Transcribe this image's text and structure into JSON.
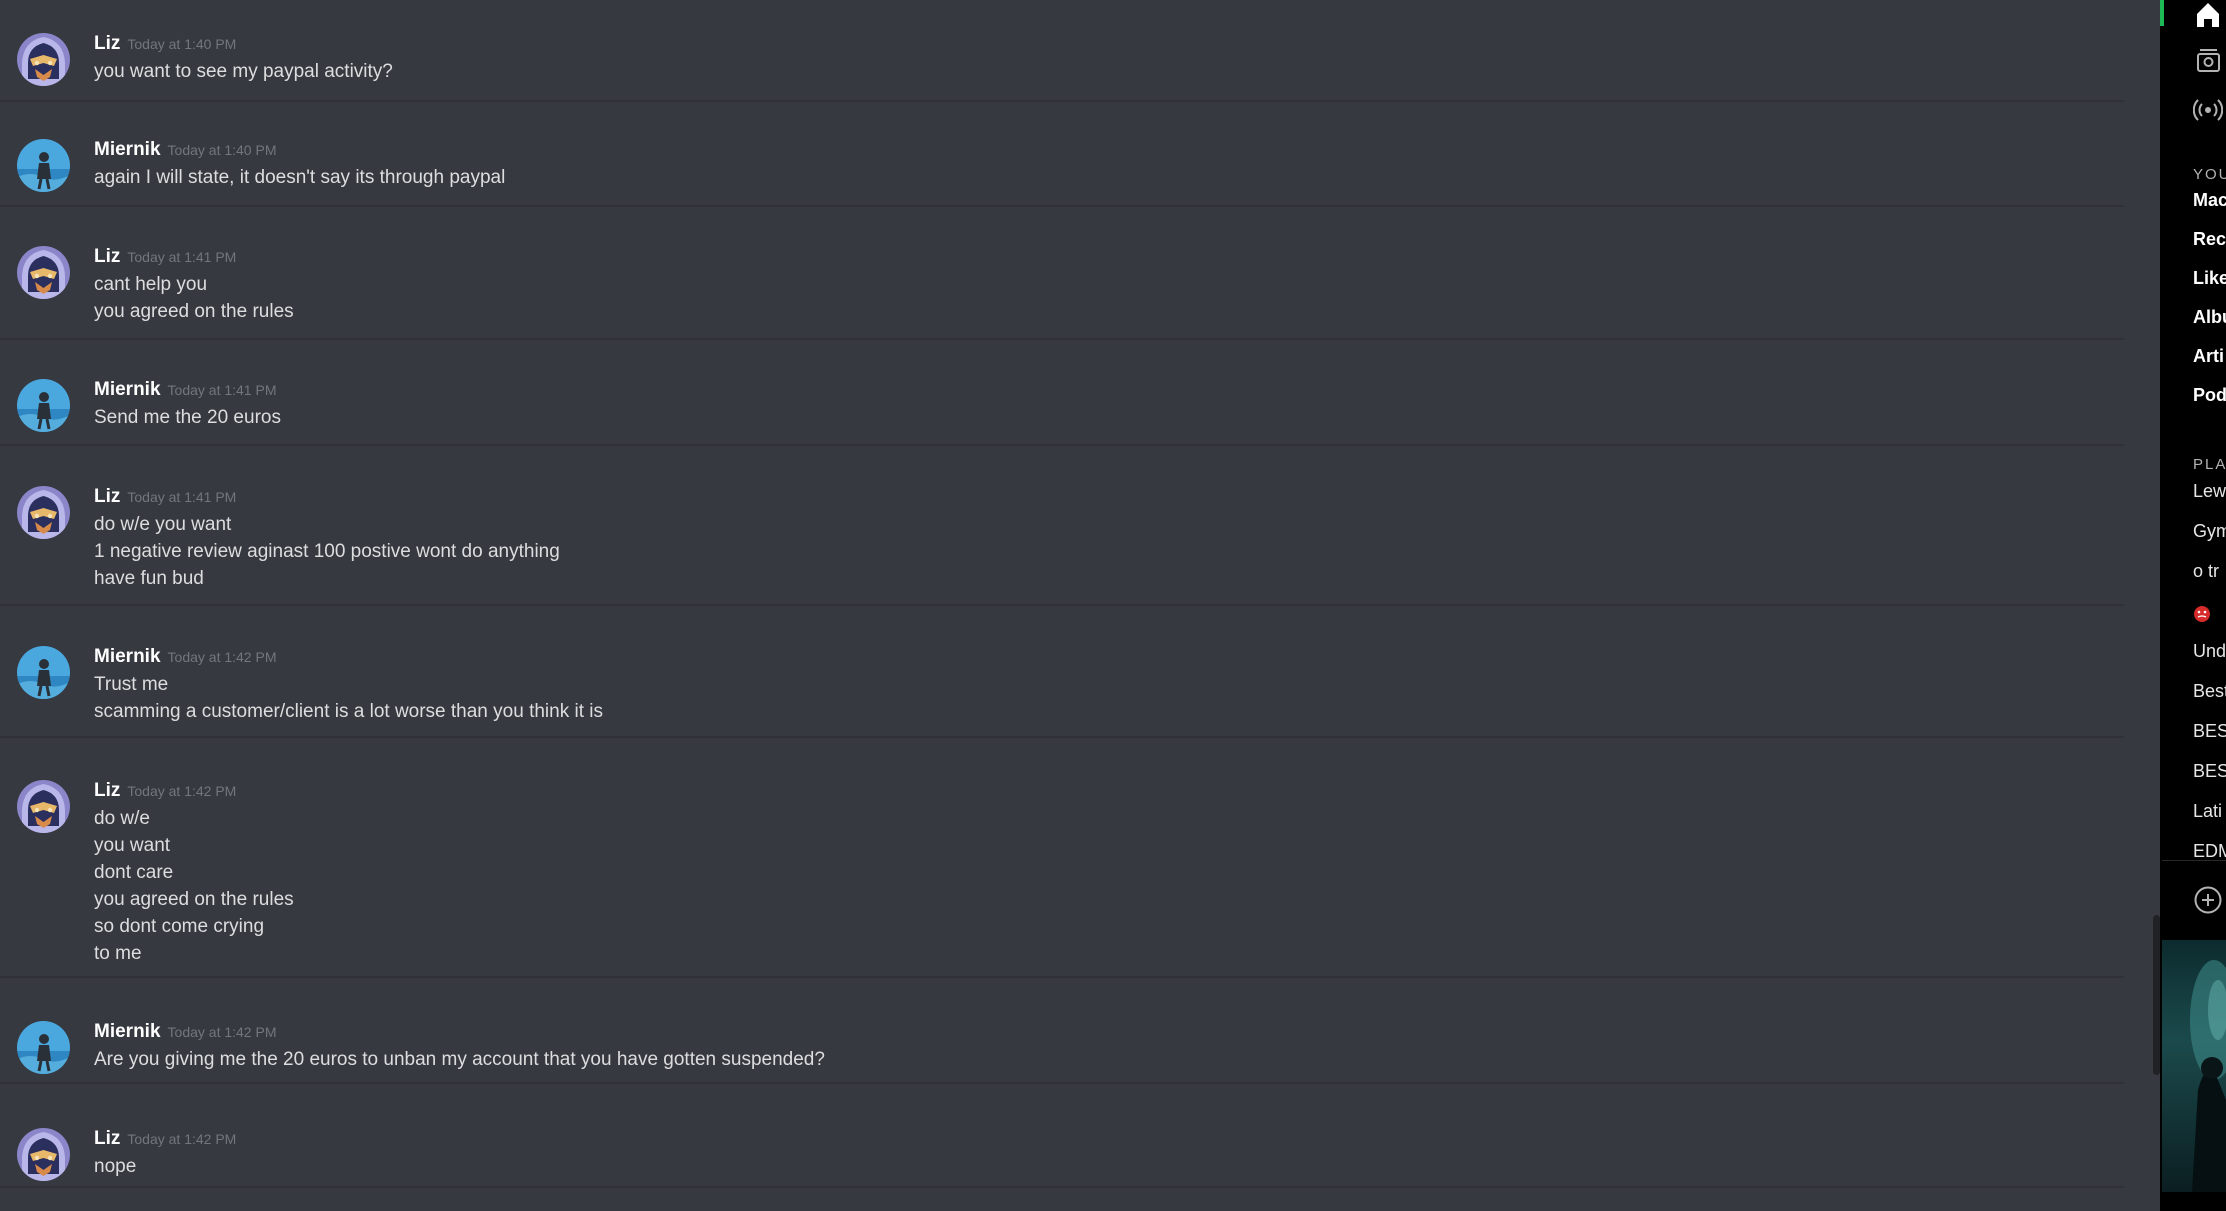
{
  "messages": [
    {
      "user": "Liz",
      "avatar": "liz-avatar",
      "time": "Today at 1:40 PM",
      "lines": [
        "you want to see my paypal activity?"
      ]
    },
    {
      "user": "Miernik",
      "avatar": "miernik-avatar",
      "time": "Today at 1:40 PM",
      "lines": [
        "again I will state, it doesn't say its through paypal"
      ]
    },
    {
      "user": "Liz",
      "avatar": "liz-avatar",
      "time": "Today at 1:41 PM",
      "lines": [
        "cant help you",
        "you agreed on the rules"
      ]
    },
    {
      "user": "Miernik",
      "avatar": "miernik-avatar",
      "time": "Today at 1:41 PM",
      "lines": [
        "Send me the 20 euros"
      ]
    },
    {
      "user": "Liz",
      "avatar": "liz-avatar",
      "time": "Today at 1:41 PM",
      "lines": [
        "do w/e you want",
        "1 negative review aginast 100 postive wont do anything",
        "have fun bud"
      ]
    },
    {
      "user": "Miernik",
      "avatar": "miernik-avatar",
      "time": "Today at 1:42 PM",
      "lines": [
        "Trust me",
        "scamming a customer/client is a lot worse than you think it is"
      ]
    },
    {
      "user": "Liz",
      "avatar": "liz-avatar",
      "time": "Today at 1:42 PM",
      "lines": [
        "do w/e",
        "you want",
        "dont care",
        "you agreed on the rules",
        "so dont come crying",
        "to me"
      ]
    },
    {
      "user": "Miernik",
      "avatar": "miernik-avatar",
      "time": "Today at 1:42 PM",
      "lines": [
        "Are you giving me the 20 euros to unban my account that you have gotten suspended?"
      ]
    },
    {
      "user": "Liz",
      "avatar": "liz-avatar",
      "time": "Today at 1:42 PM",
      "lines": [
        "nope"
      ]
    }
  ],
  "side_panel": {
    "nav_icons": [
      "home-icon",
      "library-icon",
      "podcast-icon"
    ],
    "library_section": "YOU",
    "library_items": [
      "Mac",
      "Rec",
      "Like",
      "Albu",
      "Arti",
      "Pod"
    ],
    "playlists_section": "PLA",
    "playlists": [
      "Lew",
      "Gym",
      "o tr",
      "",
      "Und",
      "Best",
      "BES",
      "BES",
      "Lati",
      "EDM"
    ],
    "playlist_icons": [
      "",
      "",
      "",
      "red-emoji-icon",
      "",
      "",
      "",
      "",
      "",
      ""
    ],
    "add_icon": "plus-circle-icon",
    "accent_color": "#1db954"
  },
  "colors": {
    "chat_bg": "#36393f",
    "username": "#ffffff",
    "message_text": "#dcddde",
    "timestamp": "#72767d"
  }
}
